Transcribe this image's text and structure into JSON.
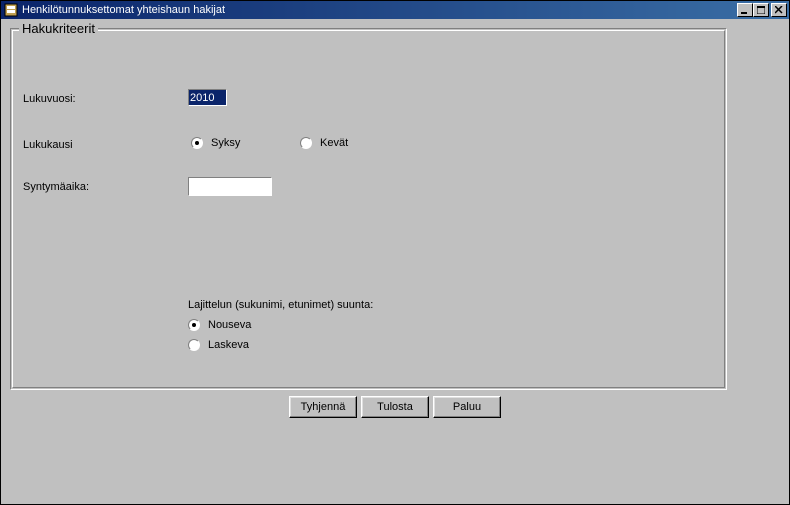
{
  "window": {
    "title": "Henkilötunnuksettomat yhteishaun hakijat"
  },
  "group": {
    "legend": "Hakukriteerit"
  },
  "labels": {
    "lukuvuosi": "Lukuvuosi:",
    "lukukausi": "Lukukausi",
    "syntymaaika": "Syntymäaika:"
  },
  "inputs": {
    "lukuvuosi_value": "2010",
    "syntymaaika_value": ""
  },
  "semester": {
    "syksy": "Syksy",
    "kevat": "Kevät",
    "selected": "syksy"
  },
  "sort": {
    "title": "Lajittelun (sukunimi, etunimet) suunta:",
    "nouseva": "Nouseva",
    "laskeva": "Laskeva",
    "selected": "nouseva"
  },
  "buttons": {
    "tyhjenna": "Tyhjennä",
    "tulosta": "Tulosta",
    "paluu": "Paluu"
  },
  "window_controls": {
    "minimize": "_",
    "maximize": "□",
    "close": "×"
  }
}
